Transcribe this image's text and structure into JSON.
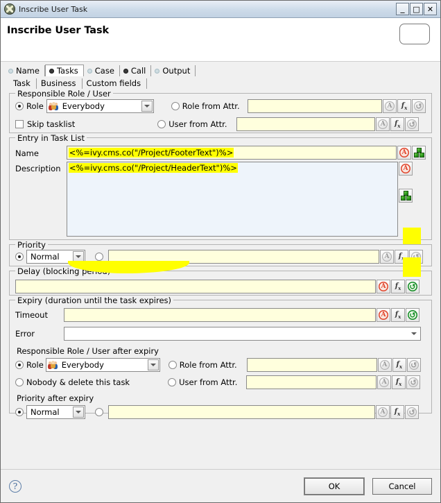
{
  "window": {
    "title": "Inscribe User Task",
    "icon": "ivy-logo-icon",
    "controls": {
      "minimize": "_",
      "maximize": "□",
      "close": "✕"
    }
  },
  "header": {
    "title": "Inscribe User Task",
    "shape_icon": "rounded-rect-shape-icon"
  },
  "tabs": [
    {
      "label": "Name",
      "dot": "light",
      "selected": false
    },
    {
      "label": "Tasks",
      "dot": "dark",
      "selected": true
    },
    {
      "label": "Case",
      "dot": "light",
      "selected": false
    },
    {
      "label": "Call",
      "dot": "dark",
      "selected": false
    },
    {
      "label": "Output",
      "dot": "light",
      "selected": false
    }
  ],
  "subtabs": [
    {
      "label": "Task",
      "selected": true
    },
    {
      "label": "Business",
      "selected": false
    },
    {
      "label": "Custom fields",
      "selected": false
    }
  ],
  "responsible": {
    "legend": "Responsible Role / User",
    "role_label": "Role",
    "role_value": "Everybody",
    "skip_tasklist_label": "Skip tasklist",
    "role_from_attr_label": "Role from Attr.",
    "role_from_attr_value": "",
    "user_from_attr_label": "User from Attr.",
    "user_from_attr_value": ""
  },
  "entry": {
    "legend": "Entry in Task List",
    "name_label": "Name",
    "name_value": "<%=ivy.cms.co(\"/Project/FooterText\")%>",
    "description_label": "Description",
    "description_value": "<%=ivy.cms.co(\"/Project/HeaderText\")%>"
  },
  "priority": {
    "legend": "Priority",
    "value": "Normal",
    "expr_value": ""
  },
  "delay": {
    "legend": "Delay (blocking period)",
    "value": ""
  },
  "expiry": {
    "legend": "Expiry (duration until the task expires)",
    "timeout_label": "Timeout",
    "timeout_value": "",
    "error_label": "Error",
    "error_value": "",
    "responsible_label": "Responsible Role / User after expiry",
    "role_label": "Role",
    "role_value": "Everybody",
    "nobody_label": "Nobody & delete this task",
    "role_from_attr_label": "Role from Attr.",
    "role_from_attr_value": "",
    "user_from_attr_label": "User from Attr.",
    "user_from_attr_value": "",
    "priority_after_label": "Priority after expiry",
    "priority_value": "Normal",
    "priority_expr_value": ""
  },
  "icon_buttons": {
    "cms_label": "A",
    "fx_label": "f",
    "fx_sub": "x",
    "reset_label": "↺"
  },
  "footer": {
    "help": "?",
    "ok": "OK",
    "cancel": "Cancel"
  },
  "colors": {
    "highlight": "#ffff00",
    "field_bg": "#ffffdd",
    "textarea_bg": "#eef4fb",
    "titlebar": "#c9d8e8",
    "accent_red": "#e0432a",
    "accent_green": "#0f8a22"
  }
}
